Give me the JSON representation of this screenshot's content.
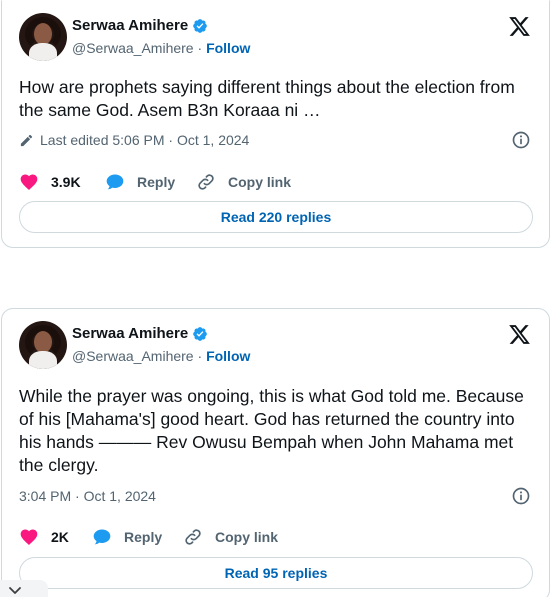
{
  "tweets": [
    {
      "author": {
        "display_name": "Serwaa Amihere",
        "handle": "@Serwaa_Amihere",
        "verified": true
      },
      "follow_label": "Follow",
      "handle_separator": "·",
      "text": "How are prophets saying different things about the election from the same God. Asem B3n Koraaa ni …",
      "edited_label": "Last edited 5:06 PM · Oct 1, 2024",
      "likes": "3.9K",
      "reply_label": "Reply",
      "copy_link_label": "Copy link",
      "read_replies_label": "Read 220 replies"
    },
    {
      "author": {
        "display_name": "Serwaa Amihere",
        "handle": "@Serwaa_Amihere",
        "verified": true
      },
      "follow_label": "Follow",
      "handle_separator": "·",
      "text": "While the prayer was ongoing, this is what God told me. Because of his [Mahama's] good heart. God has returned the country into his hands ——— Rev Owusu Bempah when John Mahama met the clergy.",
      "timestamp": "3:04 PM · Oct 1, 2024",
      "likes": "2K",
      "reply_label": "Reply",
      "copy_link_label": "Copy link",
      "read_replies_label": "Read 95 replies"
    }
  ],
  "icons": {
    "verified": "verified-badge-icon",
    "x_logo": "x-logo-icon",
    "pencil": "pencil-icon",
    "info": "info-icon",
    "heart": "heart-icon",
    "reply": "reply-bubble-icon",
    "link": "link-icon",
    "collapse": "chevron-down-icon"
  },
  "colors": {
    "text": "#0f1419",
    "secondary": "#536471",
    "link_blue": "#0064b4",
    "verified_blue": "#1d9bf0",
    "heart_pink": "#f91880",
    "border": "#cfd9de"
  }
}
